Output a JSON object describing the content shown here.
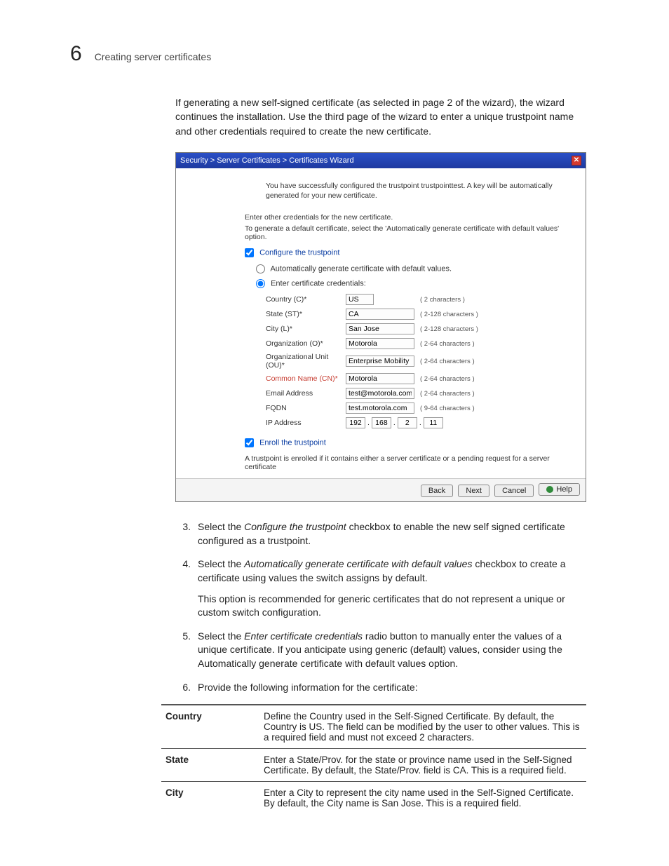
{
  "header": {
    "chapter_number": "6",
    "chapter_title": "Creating server certificates"
  },
  "intro_para": "If generating a new self-signed certificate (as selected in page 2 of the wizard), the wizard continues the installation. Use the third page of the wizard to enter a unique trustpoint name and other credentials required to create the new certificate.",
  "wizard": {
    "title": "Security > Server Certificates > Certificates Wizard",
    "msg_success": "You have successfully configured the trustpoint trustpointtest. A key will be automatically generated for your new certificate.",
    "msg_other1": "Enter other credentials for the new certificate.",
    "msg_other2": "To generate a default certificate, select the 'Automatically generate certificate with default values' option.",
    "configure_trustpoint": "Configure the trustpoint",
    "radio_auto": "Automatically generate certificate with default values.",
    "radio_enter": "Enter certificate credentials:",
    "fields": {
      "country": {
        "label": "Country (C)*",
        "value": "US",
        "hint": "( 2 characters )"
      },
      "state": {
        "label": "State (ST)*",
        "value": "CA",
        "hint": "( 2-128 characters )"
      },
      "city": {
        "label": "City (L)*",
        "value": "San Jose",
        "hint": "( 2-128 characters )"
      },
      "org": {
        "label": "Organization (O)*",
        "value": "Motorola",
        "hint": "( 2-64 characters )"
      },
      "ou": {
        "label": "Organizational Unit (OU)*",
        "value": "Enterprise Mobility",
        "hint": "( 2-64 characters )"
      },
      "cn": {
        "label": "Common Name (CN)*",
        "value": "Motorola",
        "hint": "( 2-64 characters )"
      },
      "email": {
        "label": "Email Address",
        "value": "test@motorola.com",
        "hint": "( 2-64 characters )"
      },
      "fqdn": {
        "label": "FQDN",
        "value": "test.motorola.com",
        "hint": "( 9-64 characters )"
      },
      "ip": {
        "label": "IP Address",
        "oct1": "192",
        "oct2": "168",
        "oct3": "2",
        "oct4": "11"
      }
    },
    "enroll_trustpoint": "Enroll the trustpoint",
    "enroll_note": "A trustpoint is enrolled if it contains either a server certificate or a pending request for a server certificate",
    "buttons": {
      "back": "Back",
      "next": "Next",
      "cancel": "Cancel",
      "help": "Help"
    }
  },
  "steps": {
    "s3_pre": "Select the ",
    "s3_em": "Configure the trustpoint",
    "s3_post": " checkbox to enable the new self signed certificate configured as a trustpoint.",
    "s4_pre": "Select the ",
    "s4_em": "Automatically generate certificate with default values",
    "s4_post": " checkbox to create a certificate using values the switch assigns by default.",
    "s4_sub": "This option is recommended for generic certificates that do not represent a unique or custom switch configuration.",
    "s5_pre": "Select the ",
    "s5_em": "Enter certificate credentials",
    "s5_post": " radio button to manually enter the values of a unique certificate. If you anticipate using generic (default) values, consider using the Automatically generate certificate with default values option.",
    "s6": "Provide the following information for the certificate:"
  },
  "table": {
    "rows": [
      {
        "k": "Country",
        "v": "Define the Country used in the Self-Signed Certificate. By default, the Country is US. The field can be modified by the user to other values. This is a required field and must not exceed 2 characters."
      },
      {
        "k": "State",
        "v": "Enter a State/Prov. for the state or province name used in the Self-Signed Certificate. By default, the State/Prov. field is CA. This is a required field."
      },
      {
        "k": "City",
        "v": "Enter a City to represent the city name used in the Self-Signed Certificate. By default, the City name is San Jose. This is a required field."
      }
    ]
  }
}
